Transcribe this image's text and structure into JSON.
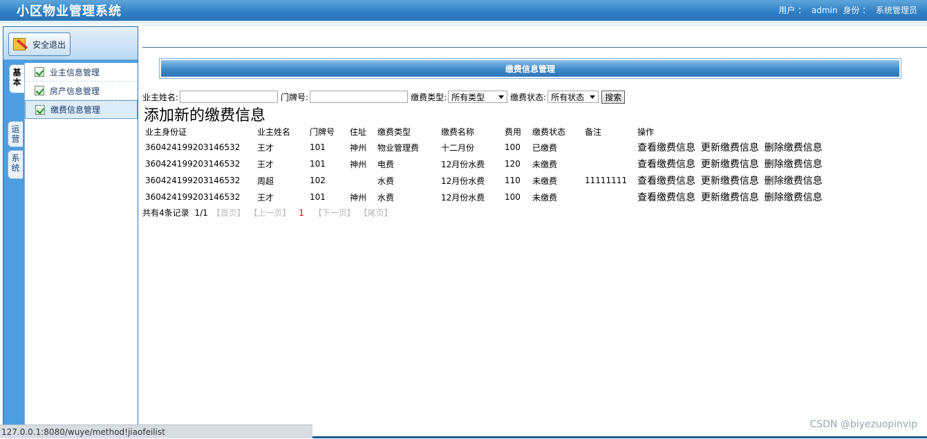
{
  "app_title": "小区物业管理系统",
  "user_info": {
    "user_label": "用户 ：",
    "user": "admin",
    "role_label": "身份 ：",
    "role": "系统管理员"
  },
  "sidebar": {
    "logout_label": "安全退出",
    "tabs": [
      {
        "label": "基本"
      },
      {
        "label": "运营"
      },
      {
        "label": "系统"
      }
    ],
    "items": [
      {
        "label": "业主信息管理"
      },
      {
        "label": "房产信息管理"
      },
      {
        "label": "缴费信息管理"
      }
    ]
  },
  "panel": {
    "title": "缴费信息管理"
  },
  "search": {
    "owner_name_label": "业主姓名:",
    "owner_name_value": "",
    "door_no_label": "门牌号:",
    "door_no_value": "",
    "fee_type_label": "缴费类型:",
    "fee_type_selected": "所有类型",
    "fee_status_label": "缴费状态:",
    "fee_status_selected": "所有状态",
    "search_button": "搜索"
  },
  "add_link": "添加新的缴费信息",
  "table": {
    "headers": [
      "业主身份证",
      "业主姓名",
      "门牌号",
      "住址",
      "缴费类型",
      "缴费名称",
      "费用",
      "缴费状态",
      "备注",
      "操作"
    ],
    "rows": [
      {
        "id_card": "360424199203146532",
        "name": "王才",
        "door": "101",
        "address": "神州",
        "type": "物业管理费",
        "fee_name": "十二月份",
        "amount": "100",
        "status": "已缴费",
        "note": ""
      },
      {
        "id_card": "360424199203146532",
        "name": "王才",
        "door": "101",
        "address": "神州",
        "type": "电费",
        "fee_name": "12月份水费",
        "amount": "120",
        "status": "未缴费",
        "note": ""
      },
      {
        "id_card": "360424199203146532",
        "name": "周超",
        "door": "102",
        "address": "",
        "type": "水费",
        "fee_name": "12月份水费",
        "amount": "110",
        "status": "未缴费",
        "note": "11111111"
      },
      {
        "id_card": "360424199203146532",
        "name": "王才",
        "door": "101",
        "address": "神州",
        "type": "水费",
        "fee_name": "12月份水费",
        "amount": "100",
        "status": "未缴费",
        "note": ""
      }
    ],
    "actions": {
      "view": "查看缴费信息",
      "update": "更新缴费信息",
      "delete": "删除缴费信息"
    }
  },
  "pager": {
    "total": "共有4条记录",
    "pages": "1/1",
    "first": "【首页】",
    "prev": "【上一页】",
    "current": "1",
    "next": "【下一页】",
    "last": "【尾页】"
  },
  "status_url": "127.0.0.1:8080/wuye/method!jiaofeilist",
  "watermark": "CSDN @biyezuopinvip"
}
